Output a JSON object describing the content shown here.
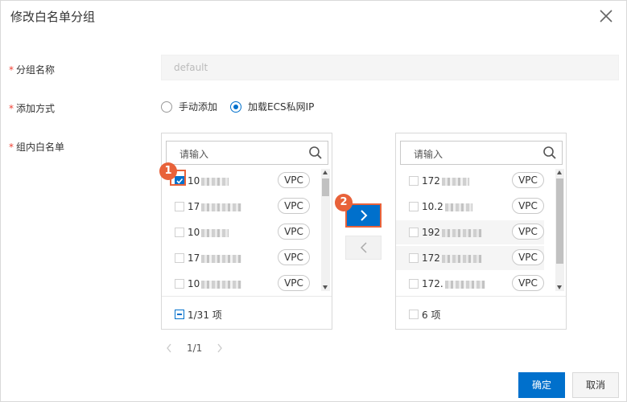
{
  "dialog": {
    "title": "修改白名单分组"
  },
  "form": {
    "group_name_label": "分组名称",
    "group_name_value": "default",
    "add_method_label": "添加方式",
    "add_method_options": [
      "手动添加",
      "加载ECS私网IP"
    ],
    "add_method_selected": "加载ECS私网IP",
    "whitelist_label": "组内白名单",
    "required_mark": "*"
  },
  "left_panel": {
    "search_placeholder": "请输入",
    "items": [
      {
        "ip": "10",
        "tag": "VPC",
        "checked": true
      },
      {
        "ip": "17",
        "tag": "VPC",
        "checked": false
      },
      {
        "ip": "10",
        "tag": "VPC",
        "checked": false
      },
      {
        "ip": "17",
        "tag": "VPC",
        "checked": false
      },
      {
        "ip": "10",
        "tag": "VPC",
        "checked": false
      }
    ],
    "footer_text": "1/31 项"
  },
  "right_panel": {
    "search_placeholder": "请输入",
    "items": [
      {
        "ip": "172",
        "tag": "VPC"
      },
      {
        "ip": "10.2",
        "tag": "VPC"
      },
      {
        "ip": "192",
        "tag": "VPC"
      },
      {
        "ip": "172",
        "tag": "VPC"
      },
      {
        "ip": "172.",
        "tag": "VPC"
      }
    ],
    "footer_text": "6 项"
  },
  "annotations": {
    "step1": "1",
    "step2": "2"
  },
  "pagination": {
    "current": "1/1"
  },
  "buttons": {
    "ok": "确定",
    "cancel": "取消"
  },
  "colors": {
    "primary": "#0070cc",
    "highlight": "#e8623a",
    "required": "#f04134"
  }
}
